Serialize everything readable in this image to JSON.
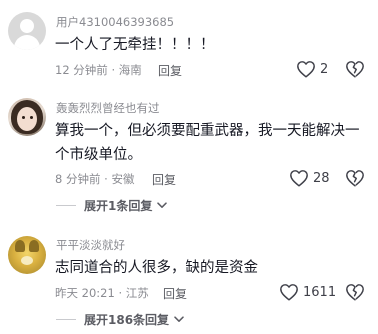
{
  "comments": [
    {
      "username": "用户4310046393685",
      "text": "一个人了无牵挂！！！！",
      "meta": "12 分钟前 · 海南",
      "reply_label": "回复",
      "likes": "2",
      "avatar": "default-user-avatar"
    },
    {
      "username": "轰轰烈烈曾经也有过",
      "text": "算我一个，但必须要配重武器，我一天能解决一个市级单位。",
      "meta": "8 分钟前 · 安徽",
      "reply_label": "回复",
      "likes": "28",
      "expand_label": "展开1条回复",
      "avatar": "girl-avatar"
    },
    {
      "username": "平平淡淡就好",
      "text": "志同道合的人很多，缺的是资金",
      "meta": "昨天 20:21 · 江苏",
      "reply_label": "回复",
      "likes": "1611",
      "expand_label": "展开186条回复",
      "avatar": "pet-avatar"
    }
  ],
  "colors": {
    "text_primary": "#161823",
    "text_secondary": "#8a8b91",
    "icon": "#3f4049"
  }
}
